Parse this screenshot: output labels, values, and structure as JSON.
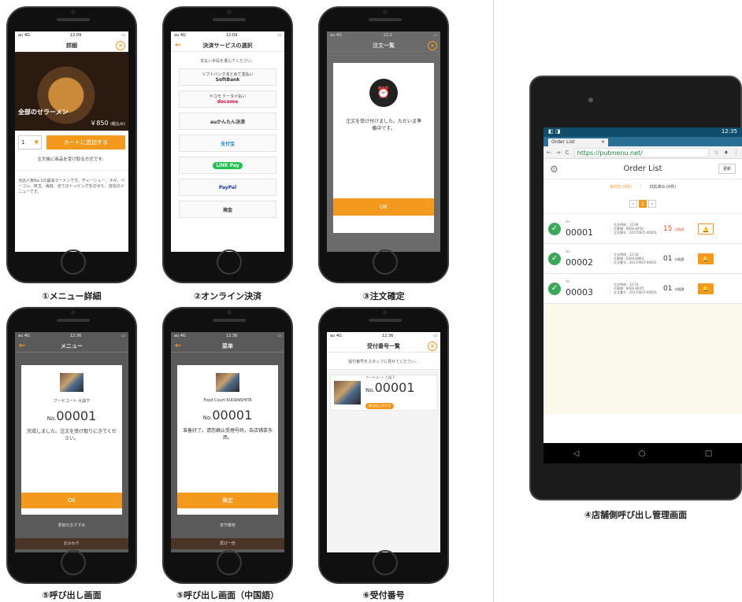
{
  "status": {
    "carrier": "au 4G",
    "time_a": "12:09",
    "time_b": "12:36"
  },
  "s1": {
    "title": "詳細",
    "dish_name": "全部のせラーメン",
    "price": "￥850",
    "tax": "(税込み)",
    "qty": "1",
    "add_button": "カートに追加する",
    "note": "注文後に商品を受け取る方式です。",
    "description": "当店人気No.1の醤油ラーメンです。チャーシュー、ネギ、ベーコン、味玉、海苔、全てのトッピングをのせた、自信のメニューです。"
  },
  "s2": {
    "title": "決済サービスの選択",
    "intro": "支払い手段を選んでください。",
    "methods": [
      {
        "top": "ソフトバンクまとめて支払い",
        "name": "SoftBank"
      },
      {
        "top": "ドコモ ケータイ払い",
        "name": "docomo"
      },
      {
        "top": "",
        "name": "auかんたん決済"
      },
      {
        "top": "",
        "name": "支付宝"
      },
      {
        "top": "",
        "name": "LINE Pay"
      },
      {
        "top": "",
        "name": "PayPal"
      },
      {
        "top": "",
        "name": "現金"
      }
    ]
  },
  "s3": {
    "title": "注文一覧",
    "message": "注文を受け付けました。ただいま準備中です。",
    "ok": "OK"
  },
  "s5": {
    "title": "メニュー",
    "place": "フードコート 九段下",
    "no_prefix": "No.",
    "number": "00001",
    "message": "完成しました。注文を受け取りにきてください。",
    "ok": "OK",
    "below1": "季節のおすすめ",
    "below2": "おかわり"
  },
  "s5c": {
    "title": "菜单",
    "place": "Food Court KUDANSHITA",
    "no_prefix": "No.",
    "number": "00001",
    "message": "准备好了。请您确认受理号码，去店铺拿东西。",
    "ok": "确定",
    "below1": "季节推荐",
    "below2": "再订一份"
  },
  "s6": {
    "title": "受付番号一覧",
    "intro": "受付番号をスタッフに見せてください。",
    "place": "フードコート 九段下",
    "no_prefix": "No.",
    "number": "00001",
    "badge": "呼び出し中です"
  },
  "captions": {
    "c1": "①メニュー詳細",
    "c2": "②オンライン決済",
    "c3": "③注文確定",
    "c4": "④店舗側呼び出し管理画面",
    "c5": "⑤呼び出し画面",
    "c5c": "⑤呼び出し画面（中国語）",
    "c6": "⑥受付番号"
  },
  "tablet": {
    "time": "12:35",
    "tab_title": "Order List",
    "url": "https://putmenu.net/",
    "title": "Order List",
    "update": "更新",
    "filter_pending": "未対応 (0件)",
    "filter_done": "対応済み (0件)",
    "rows": [
      {
        "no_label": "No.",
        "number": "00001",
        "l1": "注文時刻 : 12:09",
        "l2": "お客様 : 8000-6450",
        "l3": "注文番号 : 20170925-00001",
        "wait": "15",
        "unit": "分経過"
      },
      {
        "no_label": "No.",
        "number": "00002",
        "l1": "注文時刻 : 12:34",
        "l2": "お客様 : E000-6NK4",
        "l3": "注文番号 : 20170925-00002",
        "wait": "01",
        "unit": "分経過"
      },
      {
        "no_label": "No.",
        "number": "00003",
        "l1": "注文時刻 : 12:34",
        "l2": "お客様 : 8000-6RX5",
        "l3": "注文番号 : 20170925-00003",
        "wait": "01",
        "unit": "分経過"
      }
    ]
  },
  "colors": {
    "accent": "#f39a1e",
    "check": "#3aaa5a"
  }
}
